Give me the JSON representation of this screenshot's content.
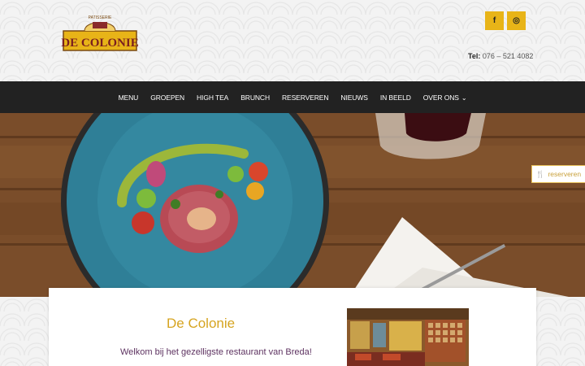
{
  "header": {
    "logo_top_text": "PATISSERIE",
    "logo_name": "DE COLONIE",
    "social": [
      {
        "icon": "facebook-icon",
        "glyph": "f"
      },
      {
        "icon": "instagram-icon",
        "glyph": "◎"
      }
    ],
    "tel_label": "Tel:",
    "tel_number": "076 – 521 4082"
  },
  "nav": {
    "items": [
      "MENU",
      "GROEPEN",
      "HIGH TEA",
      "BRUNCH",
      "RESERVEREN",
      "NIEUWS",
      "IN BEELD",
      "OVER ONS"
    ],
    "dropdown_icon": "chevron-down-icon"
  },
  "hero": {
    "reserve_tab_label": "reserveren",
    "reserve_tab_icon": "cutlery-icon"
  },
  "content": {
    "title": "De Colonie",
    "intro": "Welkom bij het gezelligste restaurant van Breda!"
  },
  "colors": {
    "accent": "#e8b418",
    "nav_bg": "#222222",
    "title": "#d6a420",
    "intro_text": "#5d3260"
  }
}
